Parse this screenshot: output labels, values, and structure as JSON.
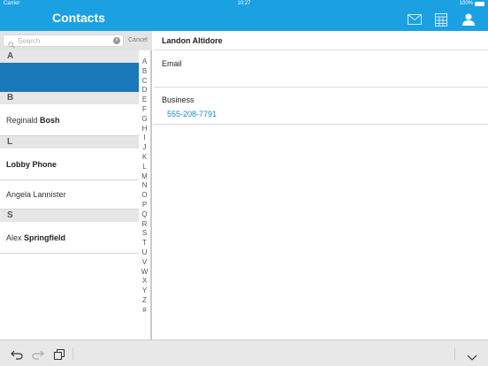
{
  "status": {
    "carrier": "Carrier",
    "time": "10:27",
    "battery": "100%"
  },
  "nav": {
    "title": "Contacts",
    "icons": [
      "mail-icon",
      "calendar-icon",
      "person-icon"
    ]
  },
  "search": {
    "placeholder": "Search",
    "cancel": "Cancel"
  },
  "sections": [
    {
      "letter": "A",
      "rows": [
        {
          "first": "",
          "last": "",
          "selected": true
        }
      ]
    },
    {
      "letter": "B",
      "rows": [
        {
          "first": "Reginald ",
          "last": "Bosh"
        }
      ]
    },
    {
      "letter": "L",
      "rows": [
        {
          "first": "",
          "last": "Lobby Phone"
        },
        {
          "first": "Angela Lannister",
          "last": ""
        }
      ]
    },
    {
      "letter": "S",
      "rows": [
        {
          "first": "Alex ",
          "last": "Springfield"
        }
      ]
    }
  ],
  "index_letters": [
    "A",
    "B",
    "C",
    "D",
    "E",
    "F",
    "G",
    "H",
    "I",
    "J",
    "K",
    "L",
    "M",
    "N",
    "O",
    "P",
    "Q",
    "R",
    "S",
    "T",
    "U",
    "V",
    "W",
    "X",
    "Y",
    "Z",
    "#"
  ],
  "detail": {
    "name": "Landon Altidore",
    "email_label": "Email",
    "business_label": "Business",
    "business_phone": "555-208-7791"
  },
  "colors": {
    "accent": "#1ba1e2",
    "selected_row": "#1a78b8",
    "link": "#1a86c9"
  },
  "toolbar": {
    "icons": [
      "undo-icon",
      "redo-icon",
      "copy-icon",
      "chevron-down-icon"
    ]
  }
}
